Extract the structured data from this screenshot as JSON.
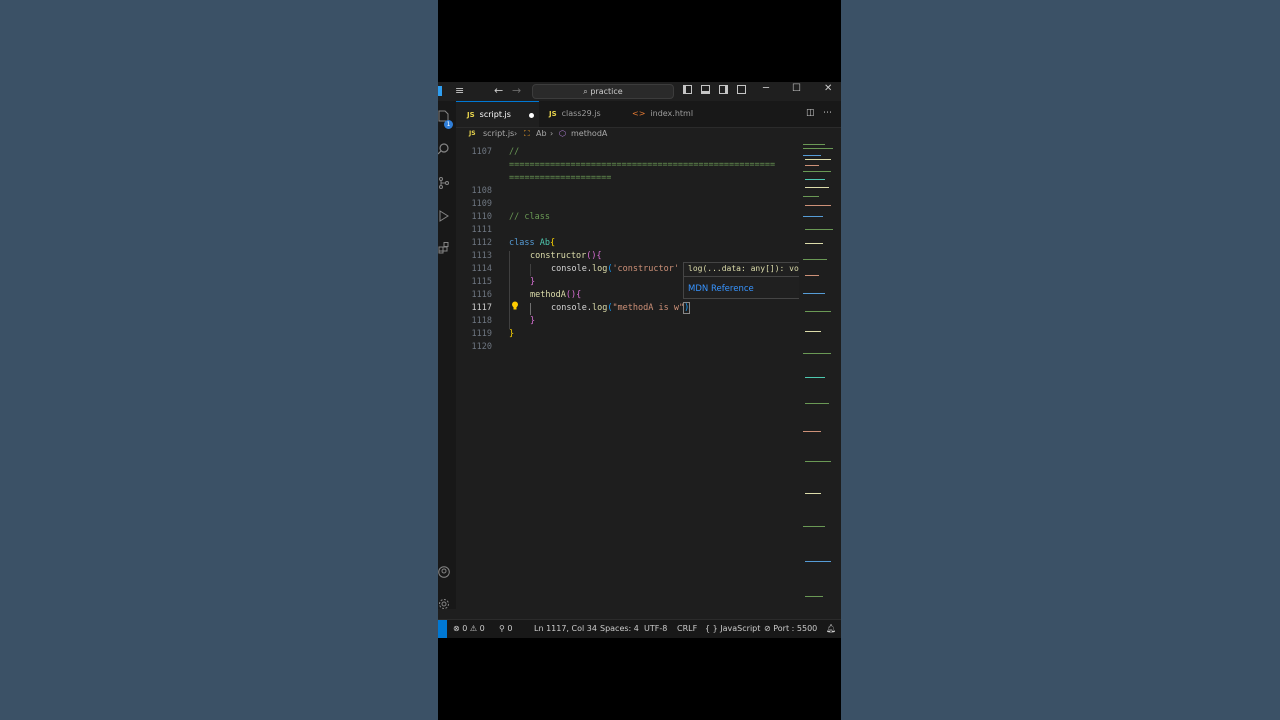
{
  "titlebar": {
    "search_text": "practice"
  },
  "tabs": [
    {
      "label": "script.js",
      "active": true,
      "modified": true,
      "type": "js"
    },
    {
      "label": "class29.js",
      "active": false,
      "modified": false,
      "type": "js"
    },
    {
      "label": "index.html",
      "active": false,
      "modified": false,
      "type": "html"
    }
  ],
  "tab_badges": {
    "js": "JS",
    "html": "<>"
  },
  "breadcrumb": {
    "file": "script.js",
    "class": "Ab",
    "method": "methodA"
  },
  "activity": {
    "explorer_badge": "1"
  },
  "editor": {
    "line_numbers": [
      "1107",
      "1108",
      "1109",
      "1110",
      "1111",
      "1112",
      "1113",
      "1114",
      "1115",
      "1116",
      "1117",
      "1118",
      "1119",
      "1120"
    ],
    "current_line": "1117",
    "code": {
      "l1107a": "//",
      "l1107b": "====================================================",
      "l1107c": "====================",
      "l1110": "// class",
      "l1112_kw": "class",
      "l1112_name": "Ab",
      "l1112_brace": "{",
      "l1113_fn": "constructor",
      "l1113_paren": "()",
      "l1113_brace": "{",
      "l1114_obj": "console",
      "l1114_dot": ".",
      "l1114_fn": "log",
      "l1114_paren": "(",
      "l1114_str": "'constructor'",
      "l1115": "}",
      "l1116_fn": "methodA",
      "l1116_paren": "()",
      "l1116_brace": "{",
      "l1117_obj": "console",
      "l1117_dot": ".",
      "l1117_fn": "log",
      "l1117_paren": "(",
      "l1117_str": "\"methodA is w\"",
      "l1117_close": ")",
      "l1118": "}",
      "l1119": "}"
    }
  },
  "hover": {
    "signature": "log(...data: any[]): void",
    "link": "MDN Reference"
  },
  "statusbar": {
    "errors": "0",
    "warnings": "0",
    "ports": "0",
    "position": "Ln 1117, Col 34",
    "spaces": "Spaces: 4",
    "encoding": "UTF-8",
    "eol": "CRLF",
    "language": "JavaScript",
    "port": "Port : 5500",
    "language_braces": "{ }"
  },
  "colors": {
    "background": "#3b5166",
    "editor_bg": "#1e1e1e",
    "accent": "#0078d4",
    "comment": "#6a9955",
    "keyword": "#569cd6",
    "class": "#4ec9b0",
    "function": "#dcdcaa",
    "string": "#ce9178"
  }
}
